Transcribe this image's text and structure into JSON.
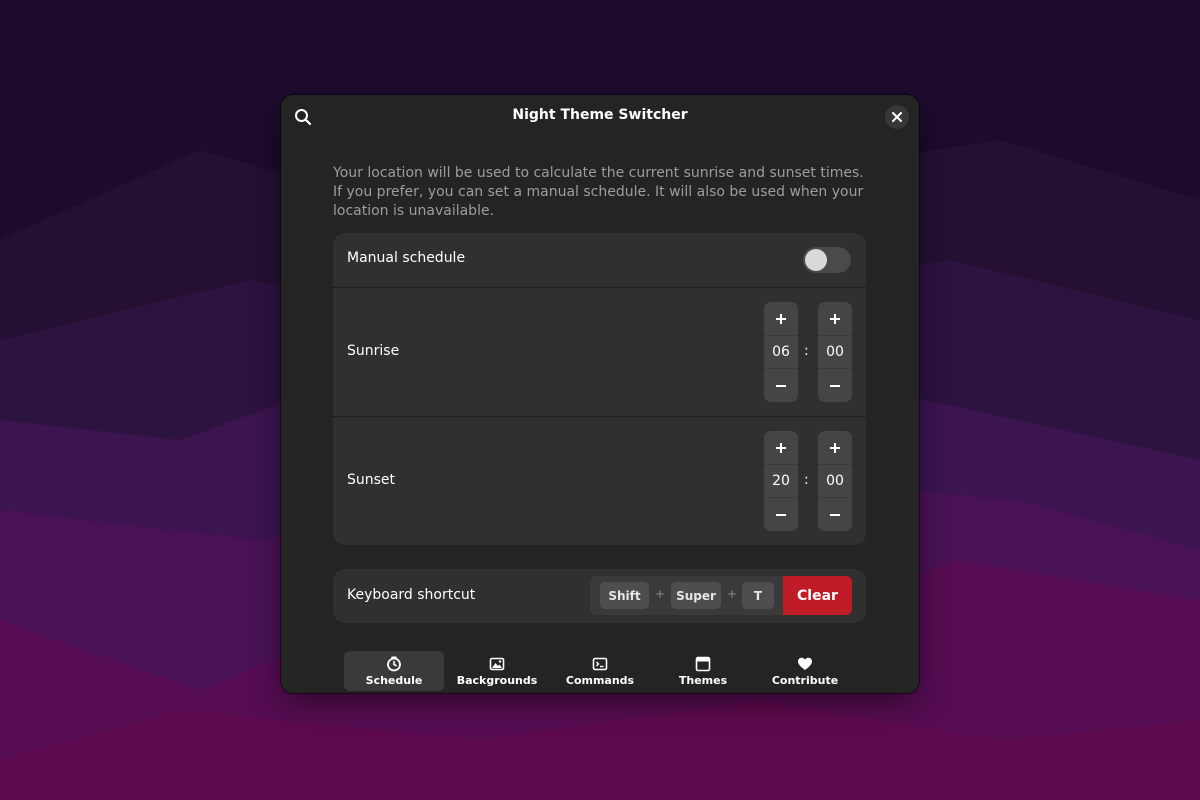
{
  "window": {
    "title": "Night Theme Switcher",
    "search_icon": "search-icon",
    "close_icon": "close-icon"
  },
  "description": "Your location will be used to calculate the current sunrise and sunset times. If you prefer, you can set a manual schedule. It will also be used when your location is unavailable.",
  "schedule": {
    "manual_label": "Manual schedule",
    "manual_enabled": false,
    "sunrise": {
      "label": "Sunrise",
      "hour": "06",
      "minute": "00"
    },
    "sunset": {
      "label": "Sunset",
      "hour": "20",
      "minute": "00"
    },
    "separator": ":",
    "increment_icon": "plus-icon",
    "decrement_icon": "minus-icon"
  },
  "shortcut": {
    "label": "Keyboard shortcut",
    "keys": [
      "Shift",
      "Super",
      "T"
    ],
    "joiner": "+",
    "clear_label": "Clear"
  },
  "tabs": [
    {
      "label": "Schedule",
      "icon": "clock-icon",
      "active": true
    },
    {
      "label": "Backgrounds",
      "icon": "image-icon",
      "active": false
    },
    {
      "label": "Commands",
      "icon": "terminal-icon",
      "active": false
    },
    {
      "label": "Themes",
      "icon": "window-icon",
      "active": false
    },
    {
      "label": "Contribute",
      "icon": "heart-icon",
      "active": false
    }
  ],
  "colors": {
    "window_bg": "#242424",
    "row_bg": "#303030",
    "destructive": "#c01c28",
    "wallpaper_top": "#1c0b2c",
    "wallpaper_bottom": "#5c0a4c"
  }
}
